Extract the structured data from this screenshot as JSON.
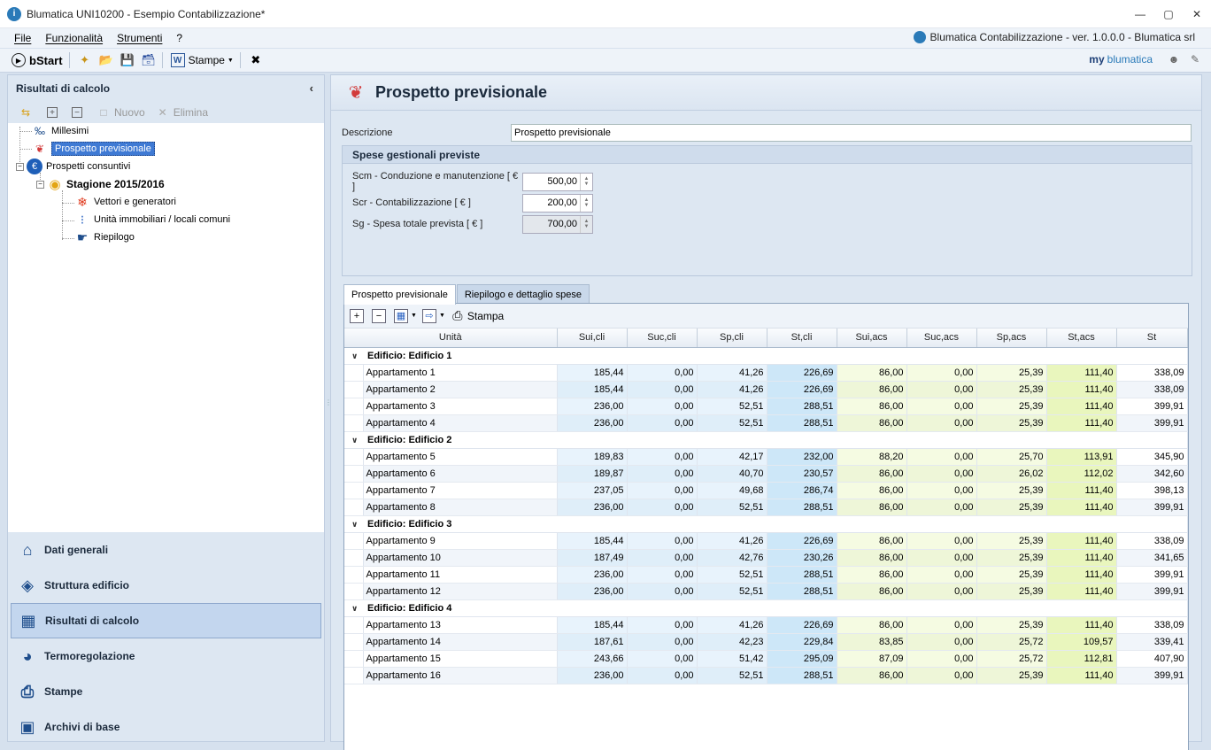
{
  "window": {
    "title": "Blumatica UNI10200 - Esempio Contabilizzazione*"
  },
  "menu": {
    "items": [
      "File",
      "Funzionalità",
      "Strumenti",
      "?"
    ],
    "product_info": "Blumatica Contabilizzazione - ver. 1.0.0.0 - Blumatica srl"
  },
  "toolbar": {
    "bstart_label": "bStart",
    "stampe_label": "Stampe",
    "my_label": "my",
    "brand_label": "blumatica"
  },
  "left_panel": {
    "title": "Risultati di calcolo",
    "tools": {
      "nuovo": "Nuovo",
      "elimina": "Elimina"
    },
    "tree": {
      "millesimi": "Millesimi",
      "prospetto_previsionale": "Prospetto previsionale",
      "prospetti_consuntivi": "Prospetti consuntivi",
      "stagione": "Stagione 2015/2016",
      "vettori": "Vettori e generatori",
      "unita": "Unità immobiliari / locali comuni",
      "riepilogo": "Riepilogo"
    },
    "nav": [
      {
        "label": "Dati generali",
        "icon": "home-icon"
      },
      {
        "label": "Struttura edificio",
        "icon": "layers-icon"
      },
      {
        "label": "Risultati di calcolo",
        "icon": "abacus-icon"
      },
      {
        "label": "Termoregolazione",
        "icon": "thermostat-icon"
      },
      {
        "label": "Stampe",
        "icon": "printer-icon"
      },
      {
        "label": "Archivi di base",
        "icon": "box-icon"
      }
    ]
  },
  "right_panel": {
    "title": "Prospetto previsionale",
    "descrizione_label": "Descrizione",
    "descrizione_value": "Prospetto previsionale",
    "group_title": "Spese gestionali previste",
    "fields": [
      {
        "label": "Scm - Conduzione e manutenzione [ € ]",
        "value": "500,00"
      },
      {
        "label": "Scr - Contabilizzazione [ € ]",
        "value": "200,00"
      },
      {
        "label": "Sg - Spesa totale prevista [ € ]",
        "value": "700,00"
      }
    ],
    "tabs": [
      "Prospetto previsionale",
      "Riepilogo e dettaglio spese"
    ],
    "grid_toolbar": {
      "stampa_label": "Stampa"
    },
    "columns": [
      "Unità",
      "Sui,cli",
      "Suc,cli",
      "Sp,cli",
      "St,cli",
      "Sui,acs",
      "Suc,acs",
      "Sp,acs",
      "St,acs",
      "St"
    ],
    "groups": [
      {
        "label": "Edificio: Edificio 1",
        "rows": [
          [
            "Appartamento 1",
            "185,44",
            "0,00",
            "41,26",
            "226,69",
            "86,00",
            "0,00",
            "25,39",
            "111,40",
            "338,09"
          ],
          [
            "Appartamento 2",
            "185,44",
            "0,00",
            "41,26",
            "226,69",
            "86,00",
            "0,00",
            "25,39",
            "111,40",
            "338,09"
          ],
          [
            "Appartamento 3",
            "236,00",
            "0,00",
            "52,51",
            "288,51",
            "86,00",
            "0,00",
            "25,39",
            "111,40",
            "399,91"
          ],
          [
            "Appartamento 4",
            "236,00",
            "0,00",
            "52,51",
            "288,51",
            "86,00",
            "0,00",
            "25,39",
            "111,40",
            "399,91"
          ]
        ]
      },
      {
        "label": "Edificio: Edificio 2",
        "rows": [
          [
            "Appartamento 5",
            "189,83",
            "0,00",
            "42,17",
            "232,00",
            "88,20",
            "0,00",
            "25,70",
            "113,91",
            "345,90"
          ],
          [
            "Appartamento 6",
            "189,87",
            "0,00",
            "40,70",
            "230,57",
            "86,00",
            "0,00",
            "26,02",
            "112,02",
            "342,60"
          ],
          [
            "Appartamento 7",
            "237,05",
            "0,00",
            "49,68",
            "286,74",
            "86,00",
            "0,00",
            "25,39",
            "111,40",
            "398,13"
          ],
          [
            "Appartamento 8",
            "236,00",
            "0,00",
            "52,51",
            "288,51",
            "86,00",
            "0,00",
            "25,39",
            "111,40",
            "399,91"
          ]
        ]
      },
      {
        "label": "Edificio: Edificio 3",
        "rows": [
          [
            "Appartamento 9",
            "185,44",
            "0,00",
            "41,26",
            "226,69",
            "86,00",
            "0,00",
            "25,39",
            "111,40",
            "338,09"
          ],
          [
            "Appartamento 10",
            "187,49",
            "0,00",
            "42,76",
            "230,26",
            "86,00",
            "0,00",
            "25,39",
            "111,40",
            "341,65"
          ],
          [
            "Appartamento 11",
            "236,00",
            "0,00",
            "52,51",
            "288,51",
            "86,00",
            "0,00",
            "25,39",
            "111,40",
            "399,91"
          ],
          [
            "Appartamento 12",
            "236,00",
            "0,00",
            "52,51",
            "288,51",
            "86,00",
            "0,00",
            "25,39",
            "111,40",
            "399,91"
          ]
        ]
      },
      {
        "label": "Edificio: Edificio 4",
        "rows": [
          [
            "Appartamento 13",
            "185,44",
            "0,00",
            "41,26",
            "226,69",
            "86,00",
            "0,00",
            "25,39",
            "111,40",
            "338,09"
          ],
          [
            "Appartamento 14",
            "187,61",
            "0,00",
            "42,23",
            "229,84",
            "83,85",
            "0,00",
            "25,72",
            "109,57",
            "339,41"
          ],
          [
            "Appartamento 15",
            "243,66",
            "0,00",
            "51,42",
            "295,09",
            "87,09",
            "0,00",
            "25,72",
            "112,81",
            "407,90"
          ],
          [
            "Appartamento 16",
            "236,00",
            "0,00",
            "52,51",
            "288,51",
            "86,00",
            "0,00",
            "25,39",
            "111,40",
            "399,91"
          ]
        ]
      }
    ]
  }
}
